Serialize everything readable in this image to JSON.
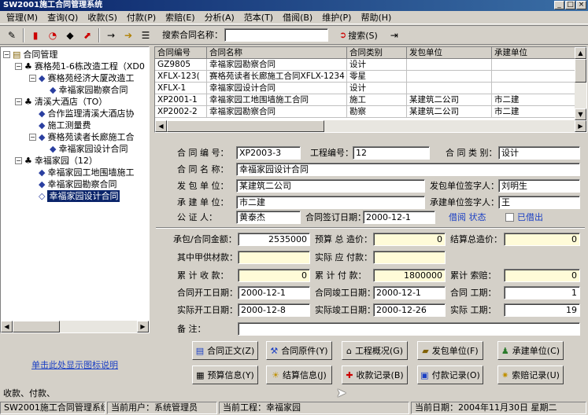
{
  "window": {
    "title": "SW2001施工合同管理系统",
    "min": "_",
    "max": "□",
    "close": "×"
  },
  "menu": [
    "管理(M)",
    "查询(Q)",
    "收款(S)",
    "付款(P)",
    "索赔(E)",
    "分析(A)",
    "范本(T)",
    "借阅(B)",
    "维护(P)",
    "帮助(H)"
  ],
  "toolbar": {
    "search_label": "搜索合同名称：",
    "search_value": "",
    "search_button": "搜索(S)"
  },
  "tree": {
    "root": "合同管理",
    "items": [
      "赛格苑1-6栋改造工程（XD0",
      "赛格苑经济大厦改造工",
      "幸福家园勘察合同",
      "清溪大酒店（TO）",
      "合作监理清溪大酒店协",
      "施工测量费",
      "赛格苑读者长廊施工合",
      "幸福家园设计合同",
      "幸福家园（12）",
      "幸福家园工地围墙施工",
      "幸福家园勘察合同",
      "幸福家园设计合同"
    ],
    "bottom_link": "单击此处显示图标说明",
    "legend": "收款、付款、"
  },
  "grid": {
    "headers": [
      "合同编号",
      "合同名称",
      "合同类别",
      "发包单位",
      "承建单位"
    ],
    "rows": [
      [
        "GZ9805",
        "幸福家园勘察合同",
        "设计",
        "",
        ""
      ],
      [
        "XFLX-123(",
        "赛格苑读者长廊施工合同XFLX-1234",
        "零星",
        "",
        ""
      ],
      [
        "XFLX-1",
        "幸福家园设计合同",
        "设计",
        "",
        ""
      ],
      [
        "XP2001-1",
        "幸福家园工地围墙施工合同",
        "施工",
        "某建筑二公司",
        "市二建"
      ],
      [
        "XP2002-2",
        "幸福家园勘察合同",
        "勘察",
        "某建筑二公司",
        "市二建"
      ]
    ]
  },
  "form": {
    "contract_no_label": "合 同 编 号：",
    "contract_no": "XP2003-3",
    "project_no_label": "工程编号：",
    "project_no": "12",
    "category_label": "合 同 类 别：",
    "category": "设计",
    "name_label": "合 同 名 称：",
    "name": "幸福家园设计合同",
    "issuer_label": "发 包 单 位：",
    "issuer": "某建筑二公司",
    "issuer_signer_label": "发包单位签字人：",
    "issuer_signer": "刘明生",
    "builder_label": "承 建 单 位：",
    "builder": "市二建",
    "builder_signer_label": "承建单位签字人：",
    "builder_signer": "王",
    "notary_label": "公 证 人：",
    "notary": "黄泰杰",
    "sign_date_label": "合同签订日期：",
    "sign_date": "2000-12-1",
    "borrow_status_label": "借阅 状态",
    "lent_label": "已借出",
    "amount_label": "承包/合同金额：",
    "amount": "2535000",
    "budget_label": "预算 总 造价：",
    "budget": "0",
    "settle_label": "结算总造价：",
    "settle": "0",
    "supply_label": "其中甲供材款：",
    "supply": "",
    "actual_pay_label": "实际 应 付款：",
    "actual_pay": "",
    "total_recv_label": "累 计 收 款：",
    "total_recv": "0",
    "total_paid_label": "累 计 付 款：",
    "total_paid": "1800000",
    "total_claim_label": "累计 索赔：",
    "total_claim": "0",
    "start_label": "合同开工日期：",
    "start": "2000-12-1",
    "end_label": "合同竣工日期：",
    "end": "2000-12-1",
    "period_label": "合同 工期：",
    "period": "1",
    "act_start_label": "实际开工日期：",
    "act_start": "2000-12-8",
    "act_end_label": "实际竣工日期：",
    "act_end": "2000-12-26",
    "act_period_label": "实际 工期：",
    "act_period": "19",
    "remark_label": "备 注：",
    "remark": ""
  },
  "buttons": [
    "合同正文(Z)",
    "合同原件(Y)",
    "工程概况(G)",
    "发包单位(F)",
    "承建单位(C)",
    "预算信息(Y)",
    "结算信息(J)",
    "收款记录(B)",
    "付款记录(O)",
    "索赔记录(U)"
  ],
  "status": {
    "app": "SW2001施工合同管理系统",
    "user": "当前用户：系统管理员",
    "project": "当前工程：幸福家园",
    "date": "当前日期：2004年11月30日 星期二"
  },
  "colors": {
    "title_start": "#0a246a",
    "title_end": "#3a6ea5",
    "selection": "#0a246a",
    "readonly_field": "#fffbd8",
    "link": "#1a3fc4"
  }
}
